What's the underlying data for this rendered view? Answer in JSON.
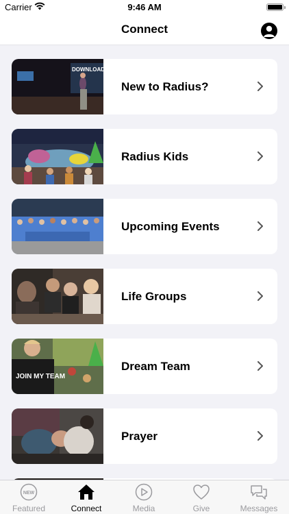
{
  "status_bar": {
    "carrier": "Carrier",
    "time": "9:46 AM"
  },
  "nav": {
    "title": "Connect"
  },
  "items": [
    {
      "label": "New to Radius?",
      "thumb_overlay": "DOWNLOAD OUR APP!"
    },
    {
      "label": "Radius Kids"
    },
    {
      "label": "Upcoming Events"
    },
    {
      "label": "Life Groups"
    },
    {
      "label": "Dream Team",
      "thumb_overlay": "JOIN MY TEAM"
    },
    {
      "label": "Prayer"
    }
  ],
  "tabs": [
    {
      "label": "Featured",
      "icon": "new-badge-icon",
      "active": false
    },
    {
      "label": "Connect",
      "icon": "home-icon",
      "active": true
    },
    {
      "label": "Media",
      "icon": "play-icon",
      "active": false
    },
    {
      "label": "Give",
      "icon": "heart-icon",
      "active": false
    },
    {
      "label": "Messages",
      "icon": "chat-bubbles-icon",
      "active": false
    }
  ],
  "colors": {
    "active_tab": "#000000",
    "inactive_tab": "#9a9a9e",
    "background": "#f2f2f7"
  }
}
